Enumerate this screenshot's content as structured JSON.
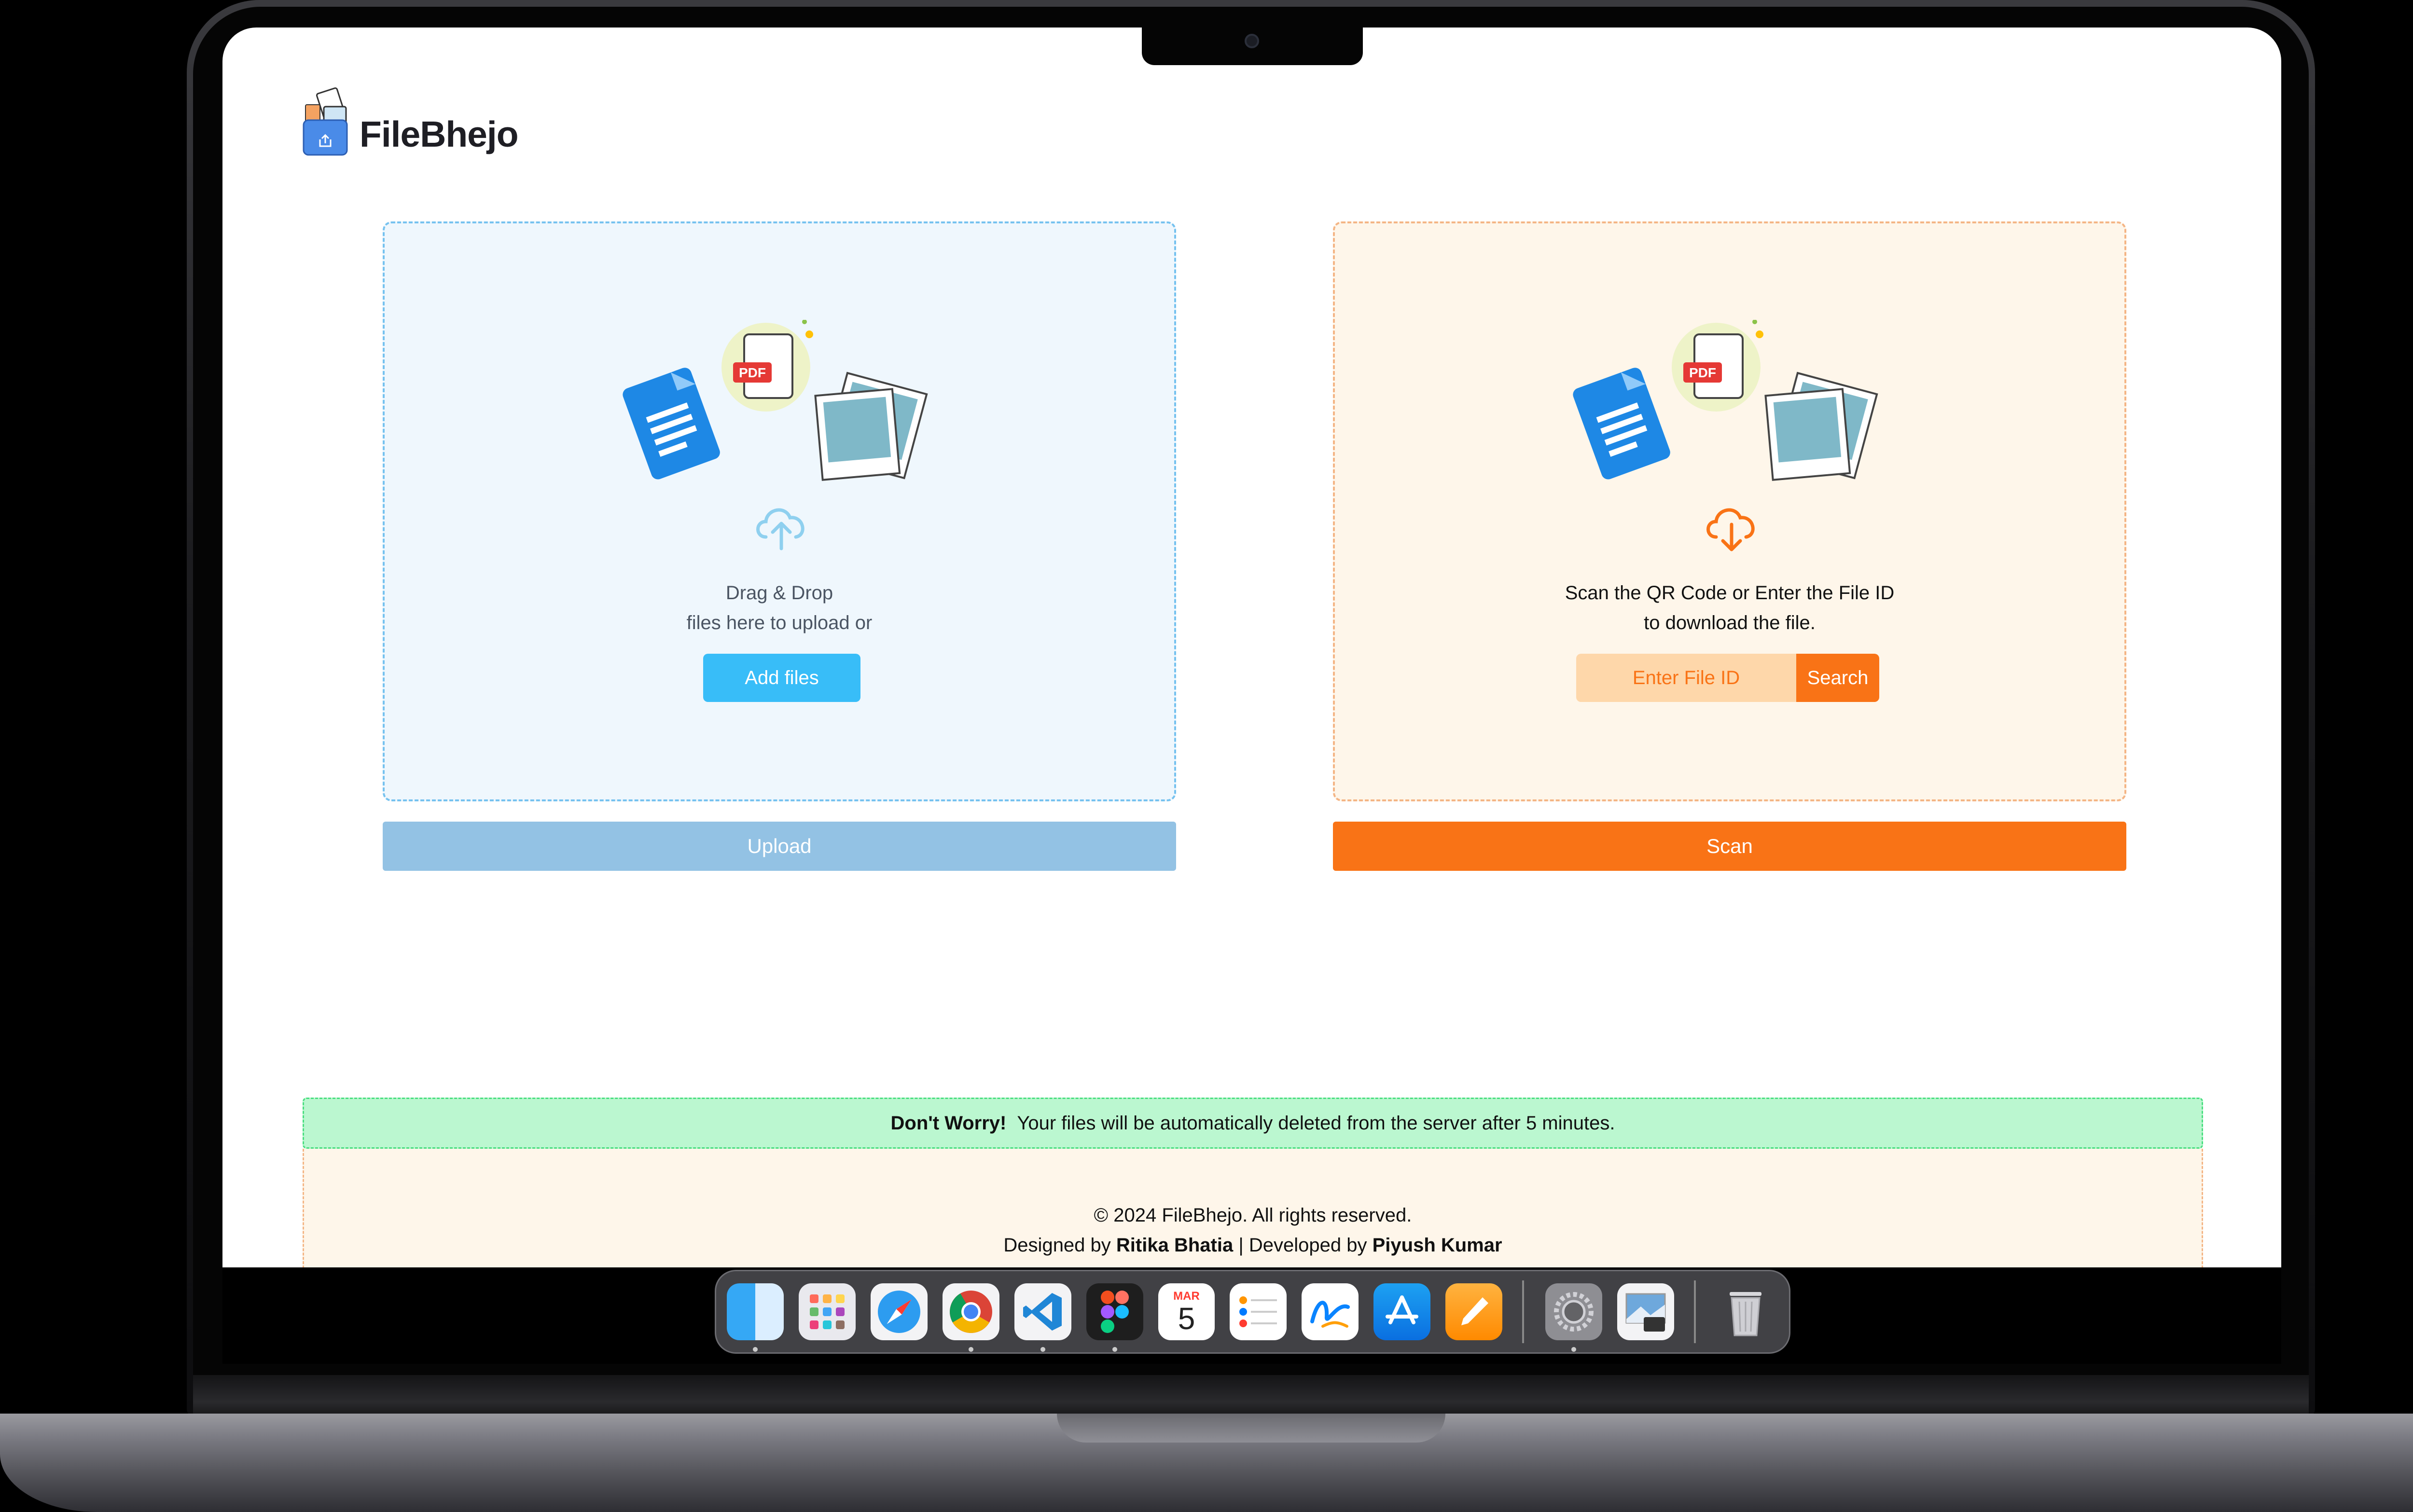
{
  "app": {
    "name": "FileBhejo"
  },
  "upload_panel": {
    "message_line1": "Drag & Drop",
    "message_line2": "files here to upload or",
    "add_files_label": "Add files",
    "upload_button_label": "Upload",
    "illustration_label": "PDF"
  },
  "scan_panel": {
    "message_line1": "Scan the QR Code or Enter the File ID",
    "message_line2": "to download the file.",
    "file_id_placeholder": "Enter File ID",
    "search_label": "Search",
    "scan_button_label": "Scan",
    "illustration_label": "PDF"
  },
  "notice": {
    "bold": "Don't Worry!",
    "text": "Your files will be automatically deleted from the server after 5 minutes."
  },
  "footer": {
    "copyright": "© 2024 FileBhejo. All rights reserved.",
    "designed_by_prefix": "Designed by",
    "designer": "Ritika Bhatia",
    "separator": "|",
    "developed_by_prefix": "Developed by",
    "developer": "Piyush Kumar"
  },
  "dock": {
    "calendar_month": "MAR",
    "calendar_day": "5",
    "apps": [
      "finder-icon",
      "launchpad-icon",
      "safari-icon",
      "chrome-icon",
      "vscode-icon",
      "figma-icon",
      "calendar-icon",
      "reminders-icon",
      "freeform-icon",
      "app-store-icon",
      "pages-icon",
      "system-settings-icon",
      "preview-icon",
      "trash-icon"
    ]
  },
  "colors": {
    "upload_accent": "#38bdf8",
    "scan_accent": "#f97316",
    "notice_bg": "#bbf7d0"
  }
}
